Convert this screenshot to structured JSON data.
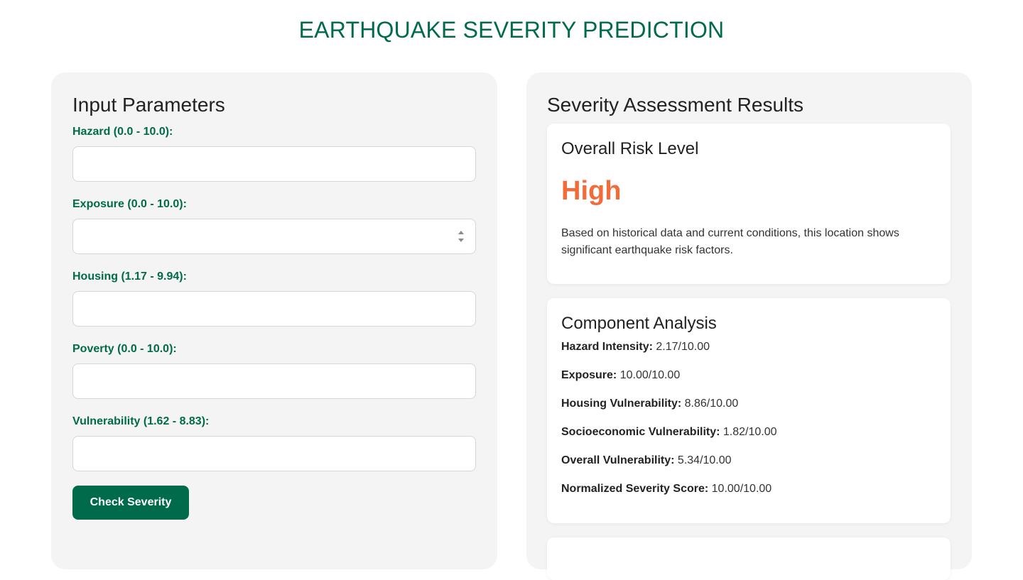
{
  "page": {
    "title": "EARTHQUAKE SEVERITY PREDICTION"
  },
  "input_panel": {
    "heading": "Input Parameters",
    "fields": [
      {
        "label": "Hazard (0.0 - 10.0):",
        "value": "",
        "placeholder": ""
      },
      {
        "label": "Exposure (0.0 - 10.0):",
        "value": "",
        "placeholder": ""
      },
      {
        "label": "Housing (1.17 - 9.94):",
        "value": "",
        "placeholder": ""
      },
      {
        "label": "Poverty (0.0 - 10.0):",
        "value": "",
        "placeholder": ""
      },
      {
        "label": "Vulnerability (1.62 - 8.83):",
        "value": "",
        "placeholder": ""
      }
    ],
    "button_label": "Check Severity"
  },
  "results_panel": {
    "heading": "Severity Assessment Results",
    "risk_card": {
      "title": "Overall Risk Level",
      "level": "High",
      "description": "Based on historical data and current conditions, this location shows significant earthquake risk factors."
    },
    "components_card": {
      "title": "Component Analysis",
      "metrics": [
        {
          "label": "Hazard Intensity:",
          "value": "2.17/10.00"
        },
        {
          "label": "Exposure:",
          "value": "10.00/10.00"
        },
        {
          "label": "Housing Vulnerability:",
          "value": "8.86/10.00"
        },
        {
          "label": "Socioeconomic Vulnerability:",
          "value": "1.82/10.00"
        },
        {
          "label": "Overall Vulnerability:",
          "value": "5.34/10.00"
        },
        {
          "label": "Normalized Severity Score:",
          "value": "10.00/10.00"
        }
      ]
    }
  },
  "colors": {
    "brand_green": "#006b4a",
    "risk_high": "#f26b3a",
    "panel_bg": "#f4f4f4"
  }
}
